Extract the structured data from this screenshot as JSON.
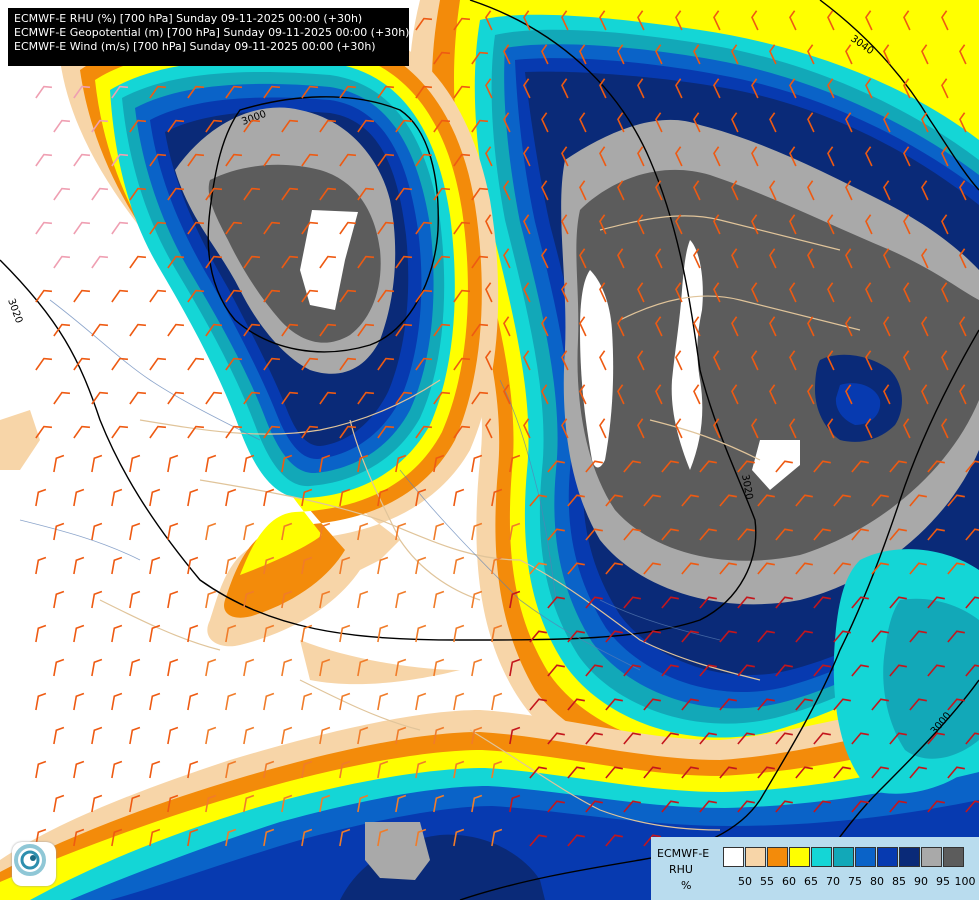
{
  "title_lines": [
    "ECMWF-E RHU (%) [700 hPa] Sunday 09-11-2025 00:00 (+30h)",
    "ECMWF-E Geopotential (m) [700 hPa] Sunday 09-11-2025 00:00 (+30h)",
    "ECMWF-E Wind (m/s) [700 hPa] Sunday 09-11-2025 00:00 (+30h)"
  ],
  "legend": {
    "model": "ECMWF-E",
    "variable": "RHU",
    "unit": "%",
    "levels": [
      "50",
      "55",
      "60",
      "65",
      "70",
      "75",
      "80",
      "85",
      "90",
      "95",
      "100"
    ],
    "colors": [
      "#ffffff",
      "#f7d5a8",
      "#f38b0a",
      "#ffff00",
      "#14d6d6",
      "#12a8b8",
      "#0a63c8",
      "#073ab0",
      "#0a2a78",
      "#a9a9a9",
      "#5c5c5c"
    ]
  },
  "contour_labels": [
    "3040",
    "3020",
    "3000",
    "3020",
    "3000"
  ],
  "icon": "ecmwf-logo-icon"
}
